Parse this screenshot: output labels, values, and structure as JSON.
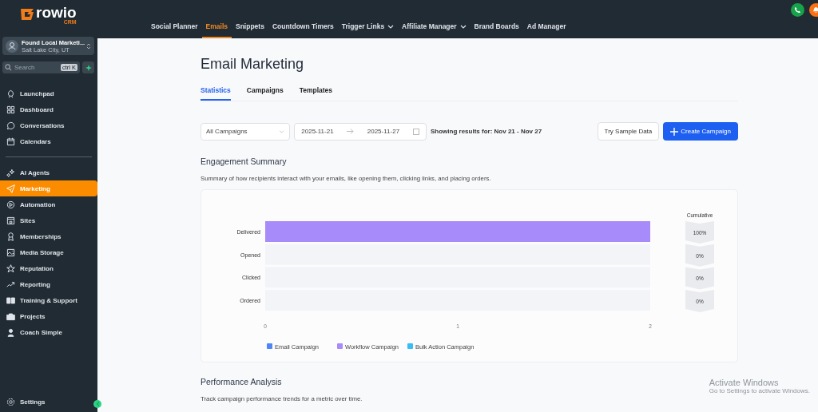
{
  "brand": {
    "name": "rowio",
    "suffix": "CRM"
  },
  "account": {
    "name": "Found Local Marketi...",
    "location": "Salt Lake City, UT"
  },
  "search": {
    "placeholder": "Search",
    "shortcut": "ctrl K"
  },
  "sidebar": {
    "sections": [
      {
        "items": [
          {
            "label": "Launchpad",
            "selected": false
          },
          {
            "label": "Dashboard",
            "selected": false
          },
          {
            "label": "Conversations",
            "selected": false
          },
          {
            "label": "Calendars",
            "selected": false
          }
        ]
      },
      {
        "items": [
          {
            "label": "AI Agents",
            "selected": false
          },
          {
            "label": "Marketing",
            "selected": true
          },
          {
            "label": "Automation",
            "selected": false
          },
          {
            "label": "Sites",
            "selected": false
          },
          {
            "label": "Memberships",
            "selected": false
          },
          {
            "label": "Media Storage",
            "selected": false
          },
          {
            "label": "Reputation",
            "selected": false
          },
          {
            "label": "Reporting",
            "selected": false
          },
          {
            "label": "Training & Support",
            "selected": false
          },
          {
            "label": "Projects",
            "selected": false
          },
          {
            "label": "Coach Simple",
            "selected": false
          }
        ]
      }
    ],
    "footer": "Settings"
  },
  "top_nav": [
    {
      "label": "Social Planner",
      "selected": false,
      "dropdown": false
    },
    {
      "label": "Emails",
      "selected": true,
      "dropdown": false
    },
    {
      "label": "Snippets",
      "selected": false,
      "dropdown": false
    },
    {
      "label": "Countdown Timers",
      "selected": false,
      "dropdown": false
    },
    {
      "label": "Trigger Links",
      "selected": false,
      "dropdown": true
    },
    {
      "label": "Affiliate Manager",
      "selected": false,
      "dropdown": true
    },
    {
      "label": "Brand Boards",
      "selected": false,
      "dropdown": false
    },
    {
      "label": "Ad Manager",
      "selected": false,
      "dropdown": false
    }
  ],
  "page_title": "Email Marketing",
  "tabs": [
    {
      "label": "Statistics",
      "selected": true
    },
    {
      "label": "Campaigns",
      "selected": false
    },
    {
      "label": "Templates",
      "selected": false
    }
  ],
  "filters": {
    "campaign_select": "All Campaigns",
    "date_from": "2025-11-21",
    "date_to": "2025-11-27",
    "results_text": "Showing results for: Nov 21 - Nov 27",
    "sample_button": "Try Sample Data",
    "create_button": "Create Campaign"
  },
  "engagement": {
    "title": "Engagement Summary",
    "description": "Summary of how recipients interact with your emails, like opening them, clicking links, and placing orders.",
    "chart_data": {
      "type": "bar",
      "orientation": "horizontal",
      "stacked": true,
      "categories": [
        "Delivered",
        "Opened",
        "Clicked",
        "Ordered"
      ],
      "series": [
        {
          "name": "Email Campaign",
          "color": "#4f86f7",
          "values": [
            0,
            0,
            0,
            0
          ]
        },
        {
          "name": "Workflow Campaign",
          "color": "#a78bfa",
          "values": [
            2,
            0,
            0,
            0
          ]
        },
        {
          "name": "Bulk Action Campaign",
          "color": "#38bdf8",
          "values": [
            0,
            0,
            0,
            0
          ]
        }
      ],
      "xlim": [
        0,
        2
      ],
      "xticks": [
        0,
        1,
        2
      ]
    },
    "cumulative": {
      "title": "Cumulative",
      "values": [
        "100%",
        "0%",
        "0%",
        "0%"
      ]
    }
  },
  "performance": {
    "title": "Performance Analysis",
    "description": "Track campaign performance trends for a metric over time."
  },
  "activation_notice": {
    "title": "Activate Windows",
    "text": "Go to Settings to activate Windows."
  }
}
